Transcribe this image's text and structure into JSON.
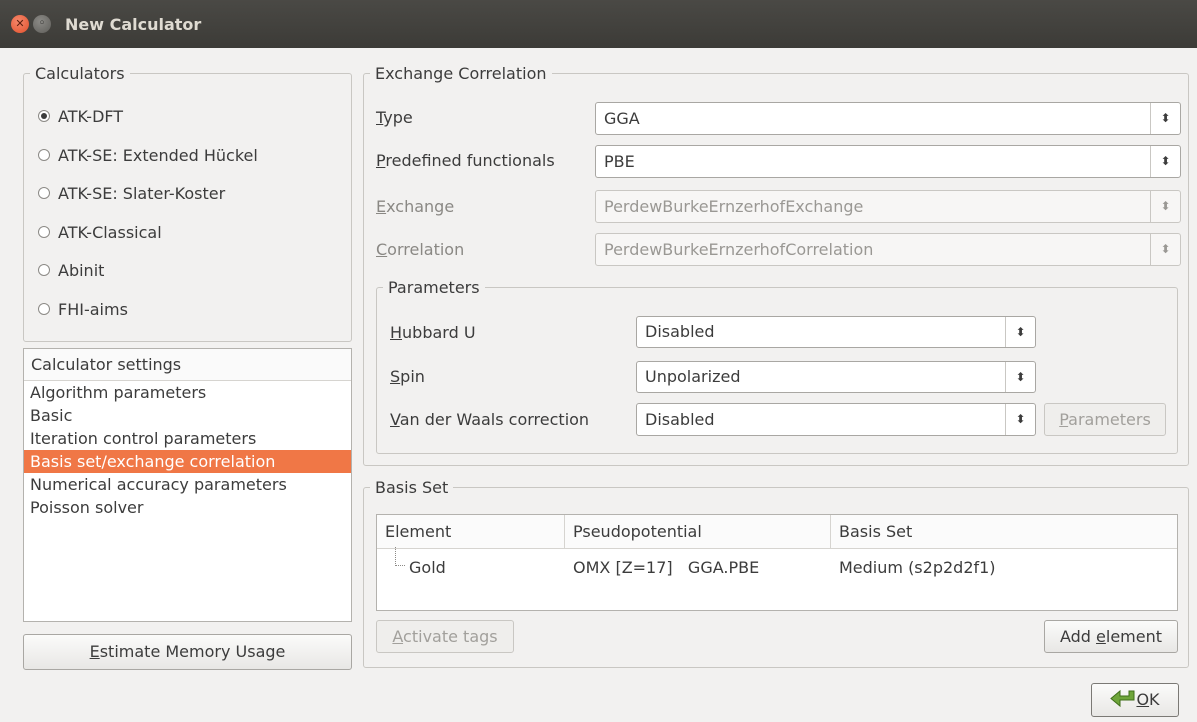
{
  "window": {
    "title": "New Calculator"
  },
  "calculators": {
    "legend": "Calculators",
    "options": [
      {
        "label": "ATK-DFT",
        "checked": true
      },
      {
        "label": "ATK-SE: Extended Hückel",
        "checked": false
      },
      {
        "label": "ATK-SE: Slater-Koster",
        "checked": false
      },
      {
        "label": "ATK-Classical",
        "checked": false
      },
      {
        "label": "Abinit",
        "checked": false
      },
      {
        "label": "FHI-aims",
        "checked": false
      }
    ]
  },
  "settings": {
    "header": "Calculator settings",
    "items": [
      "Algorithm parameters",
      "Basic",
      "Iteration control parameters",
      "Basis set/exchange correlation",
      "Numerical accuracy parameters",
      "Poisson solver"
    ],
    "selected": "Basis set/exchange correlation"
  },
  "estimate_button": {
    "mnemonic": "E",
    "rest": "stimate Memory Usage"
  },
  "exchange": {
    "legend": "Exchange Correlation",
    "type": {
      "mnemonic": "T",
      "rest": "ype",
      "value": "GGA"
    },
    "predefined": {
      "mnemonic": "P",
      "rest": "redefined functionals",
      "value": "PBE"
    },
    "exchange": {
      "mnemonic": "E",
      "rest": "xchange",
      "value": "PerdewBurkeErnzerhofExchange"
    },
    "correlation": {
      "mnemonic": "C",
      "rest": "orrelation",
      "value": "PerdewBurkeErnzerhofCorrelation"
    }
  },
  "parameters": {
    "legend": "Parameters",
    "hubbard": {
      "mnemonic": "H",
      "rest": "ubbard U",
      "value": "Disabled"
    },
    "spin": {
      "mnemonic": "S",
      "rest": "pin",
      "value": "Unpolarized"
    },
    "vdw": {
      "mnemonic": "V",
      "rest": "an der Waals correction",
      "value": "Disabled"
    },
    "params_button": {
      "mnemonic": "P",
      "rest": "arameters"
    }
  },
  "basis_set": {
    "legend": "Basis Set",
    "columns": [
      "Element",
      "Pseudopotential",
      "Basis Set"
    ],
    "rows": [
      {
        "element": "Gold",
        "pseudopotential": "OMX [Z=17]   GGA.PBE",
        "basis": "Medium (s2p2d2f1)"
      }
    ],
    "activate_button": {
      "mnemonic": "A",
      "rest": "ctivate tags"
    },
    "add_button": {
      "before": "Add ",
      "mnemonic": "e",
      "rest": "lement"
    }
  },
  "ok_button": {
    "mnemonic": "O",
    "rest": "K"
  },
  "colors": {
    "accent": "#f07746",
    "titlebar": "#3c3b37"
  },
  "icons": {
    "close": "close-icon",
    "minimize": "minimize-icon",
    "ok": "ok-arrow-icon",
    "combo": "updown-arrows-icon"
  }
}
